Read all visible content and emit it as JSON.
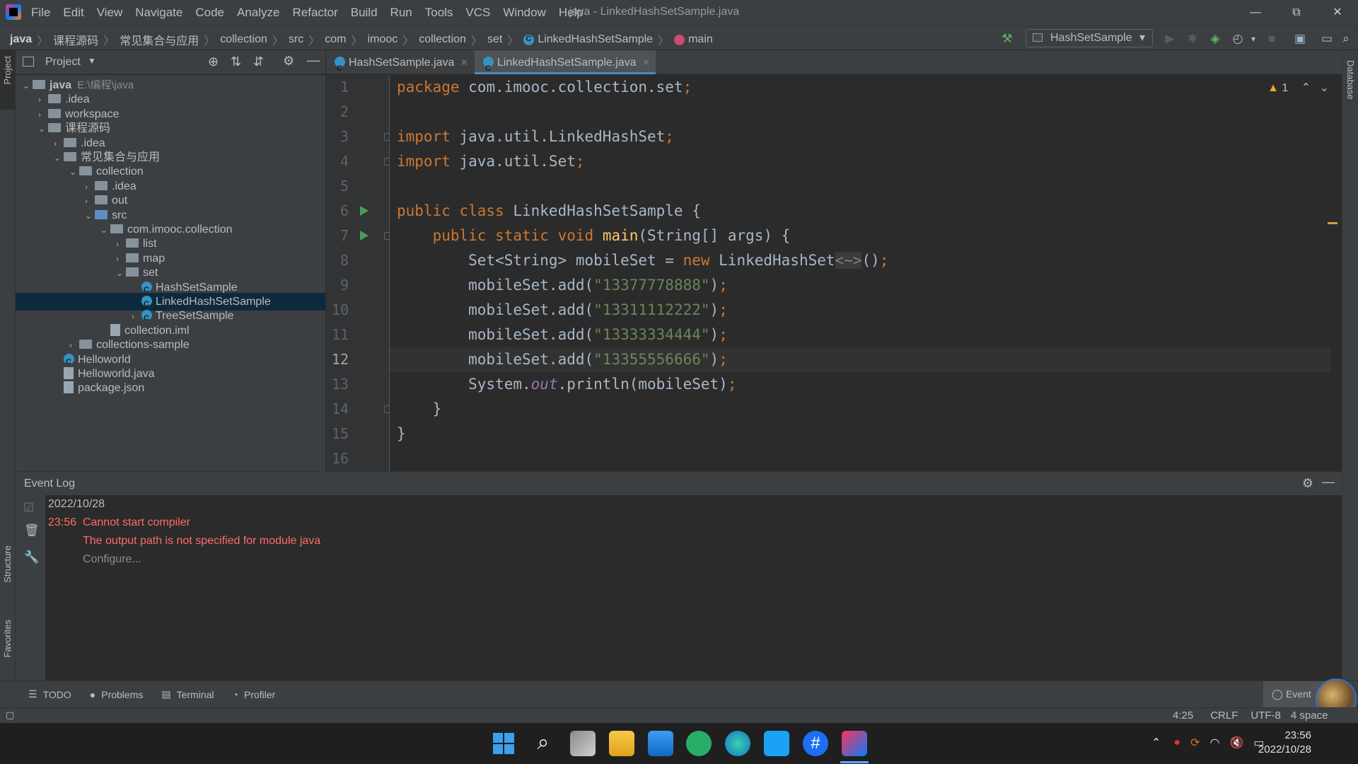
{
  "window": {
    "title": "java - LinkedHashSetSample.java",
    "menu": [
      "File",
      "Edit",
      "View",
      "Navigate",
      "Code",
      "Analyze",
      "Refactor",
      "Build",
      "Run",
      "Tools",
      "VCS",
      "Window",
      "Help"
    ],
    "controls": [
      "—",
      "⧉",
      "✕"
    ]
  },
  "breadcrumb": {
    "items": [
      "java",
      "课程源码",
      "常见集合与应用",
      "collection",
      "src",
      "com",
      "imooc",
      "collection",
      "set",
      "LinkedHashSetSample",
      "main"
    ]
  },
  "toolbar": {
    "run_config": "HashSetSample"
  },
  "project": {
    "title": "Project",
    "tree": [
      {
        "label": "java",
        "extra": "E:\\编程\\java",
        "depth": 0,
        "expanded": true,
        "type": "folder"
      },
      {
        "label": ".idea",
        "depth": 1,
        "expanded": false,
        "type": "folder"
      },
      {
        "label": "workspace",
        "depth": 1,
        "expanded": false,
        "type": "folder"
      },
      {
        "label": "课程源码",
        "depth": 1,
        "expanded": true,
        "type": "folder"
      },
      {
        "label": ".idea",
        "depth": 2,
        "expanded": false,
        "type": "folder"
      },
      {
        "label": "常见集合与应用",
        "depth": 2,
        "expanded": true,
        "type": "folder"
      },
      {
        "label": "collection",
        "depth": 3,
        "expanded": true,
        "type": "folder"
      },
      {
        "label": ".idea",
        "depth": 4,
        "expanded": false,
        "type": "folder"
      },
      {
        "label": "out",
        "depth": 4,
        "expanded": false,
        "type": "folder"
      },
      {
        "label": "src",
        "depth": 4,
        "expanded": true,
        "type": "srcfolder"
      },
      {
        "label": "com.imooc.collection",
        "depth": 5,
        "expanded": true,
        "type": "package"
      },
      {
        "label": "list",
        "depth": 6,
        "expanded": false,
        "type": "package"
      },
      {
        "label": "map",
        "depth": 6,
        "expanded": false,
        "type": "package"
      },
      {
        "label": "set",
        "depth": 6,
        "expanded": true,
        "type": "package"
      },
      {
        "label": "HashSetSample",
        "depth": 7,
        "type": "class"
      },
      {
        "label": "LinkedHashSetSample",
        "depth": 7,
        "type": "class",
        "selected": true
      },
      {
        "label": "TreeSetSample",
        "depth": 7,
        "expanded": false,
        "type": "class"
      },
      {
        "label": "collection.iml",
        "depth": 5,
        "type": "file"
      },
      {
        "label": "collections-sample",
        "depth": 3,
        "expanded": false,
        "type": "folder"
      },
      {
        "label": "Helloworld",
        "depth": 2,
        "type": "class"
      },
      {
        "label": "Helloworld.java",
        "depth": 2,
        "type": "file"
      },
      {
        "label": "package.json",
        "depth": 2,
        "type": "file"
      }
    ]
  },
  "tabs": [
    {
      "label": "HashSetSample.java",
      "active": false
    },
    {
      "label": "LinkedHashSetSample.java",
      "active": true
    }
  ],
  "editor": {
    "warnings": "1",
    "current_line": 12,
    "lines": [
      "1",
      "2",
      "3",
      "4",
      "5",
      "6",
      "7",
      "8",
      "9",
      "10",
      "11",
      "12",
      "13",
      "14",
      "15",
      "16"
    ],
    "code": {
      "l1_kw": "package",
      "l1_rest": " com.imooc.collection.set",
      "l3_kw": "import",
      "l3_rest": " java.util.LinkedHashSet",
      "l4_kw": "import",
      "l4_rest": " java.util.Set",
      "l6_kw": "public class",
      "l6_rest": " LinkedHashSetSample {",
      "l7_kw": "    public static void",
      "l7_fn": "main",
      "l7_rest": "(String[] args) {",
      "l8_a": "        Set<String> mobileSet = ",
      "l8_kw": "new",
      "l8_b": " LinkedHashSet",
      "l8_dim": "<~>",
      "l8_c": "()",
      "add_prefix": "        mobileSet.add(",
      "s1": "\"13377778888\"",
      "s2": "\"13311112222\"",
      "s3": "\"13333334444\"",
      "s4": "\"13355556666\"",
      "l13_a": "        System.",
      "l13_static": "out",
      "l13_b": ".println(mobileSet)",
      "l14": "    }",
      "l15": "}"
    }
  },
  "event_log": {
    "title": "Event Log",
    "date": "2022/10/28",
    "time": "23:56",
    "message": "Cannot start compiler",
    "detail": "The output path is not specified for module java",
    "action": "Configure..."
  },
  "tool_windows": [
    "TODO",
    "Problems",
    "Terminal",
    "Profiler"
  ],
  "event_button": "Event",
  "status": {
    "position": "4:25",
    "line_sep": "CRLF",
    "encoding": "UTF-8",
    "indent": "4 space"
  },
  "side_tabs": {
    "left_top": "Project",
    "left_mid": "Structure",
    "left_bottom": "Favorites",
    "right": "Database"
  },
  "taskbar": {
    "time": "23:56",
    "date": "2022/10/28"
  }
}
